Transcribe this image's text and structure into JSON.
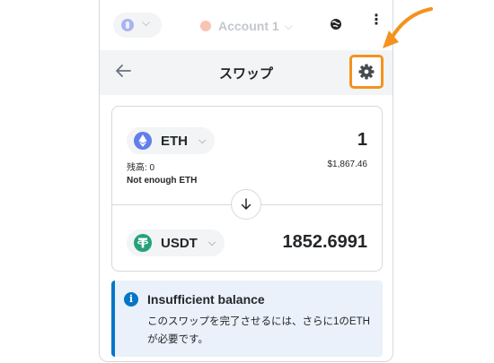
{
  "topbar": {
    "account_name": "Account 1",
    "kebab": "⋮"
  },
  "header": {
    "title": "スワップ"
  },
  "from": {
    "symbol": "ETH",
    "amount": "1",
    "balance": "残高: 0",
    "fiat_value": "$1,867.46",
    "warning": "Not enough ETH"
  },
  "to": {
    "symbol": "USDT",
    "amount": "1852.6991"
  },
  "alert": {
    "title": "Insufficient balance",
    "body": "このスワップを完了させるには、さらに1のETHが必要です。",
    "icon": "i"
  },
  "colors": {
    "accent_orange": "#f5921e",
    "info_blue": "#0376c9",
    "eth": "#627eea",
    "usdt": "#26a17b"
  }
}
